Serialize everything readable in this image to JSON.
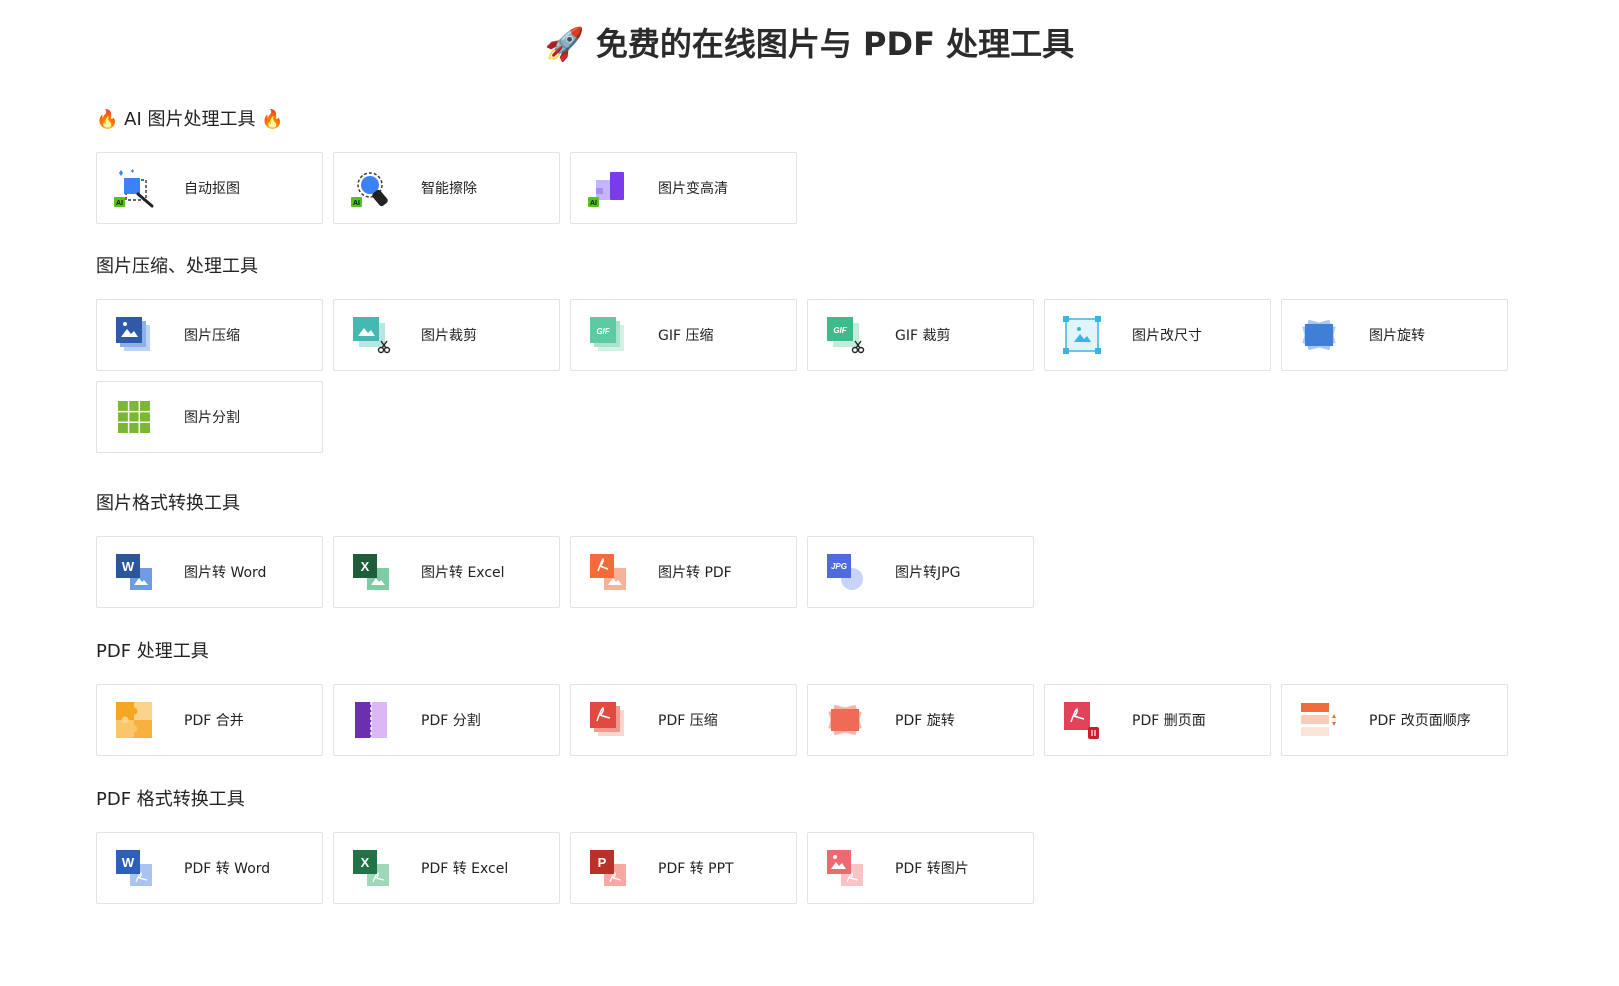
{
  "page": {
    "title": "🚀 免费的在线图片与 PDF 处理工具"
  },
  "sections": [
    {
      "title": "🔥 AI 图片处理工具 🔥",
      "items": [
        {
          "label": "自动抠图",
          "icon": "ai-cutout-icon"
        },
        {
          "label": "智能擦除",
          "icon": "ai-eraser-icon"
        },
        {
          "label": "图片变高清",
          "icon": "ai-enhance-icon"
        }
      ]
    },
    {
      "title": "图片压缩、处理工具",
      "items": [
        {
          "label": "图片压缩",
          "icon": "image-compress-icon"
        },
        {
          "label": "图片裁剪",
          "icon": "image-crop-icon"
        },
        {
          "label": "GIF 压缩",
          "icon": "gif-compress-icon"
        },
        {
          "label": "GIF 裁剪",
          "icon": "gif-crop-icon"
        },
        {
          "label": "图片改尺寸",
          "icon": "image-resize-icon"
        },
        {
          "label": "图片旋转",
          "icon": "image-rotate-icon"
        },
        {
          "label": "图片分割",
          "icon": "image-split-icon"
        }
      ]
    },
    {
      "title": "图片格式转换工具",
      "items": [
        {
          "label": "图片转 Word",
          "icon": "image-to-word-icon"
        },
        {
          "label": "图片转 Excel",
          "icon": "image-to-excel-icon"
        },
        {
          "label": "图片转 PDF",
          "icon": "image-to-pdf-icon"
        },
        {
          "label": "图片转JPG",
          "icon": "image-to-jpg-icon"
        }
      ]
    },
    {
      "title": "PDF 处理工具",
      "items": [
        {
          "label": "PDF 合并",
          "icon": "pdf-merge-icon"
        },
        {
          "label": "PDF 分割",
          "icon": "pdf-split-icon"
        },
        {
          "label": "PDF 压缩",
          "icon": "pdf-compress-icon"
        },
        {
          "label": "PDF 旋转",
          "icon": "pdf-rotate-icon"
        },
        {
          "label": "PDF 删页面",
          "icon": "pdf-delete-page-icon"
        },
        {
          "label": "PDF 改页面顺序",
          "icon": "pdf-reorder-icon"
        }
      ]
    },
    {
      "title": "PDF 格式转换工具",
      "items": [
        {
          "label": "PDF 转 Word",
          "icon": "pdf-to-word-icon"
        },
        {
          "label": "PDF 转 Excel",
          "icon": "pdf-to-excel-icon"
        },
        {
          "label": "PDF 转 PPT",
          "icon": "pdf-to-ppt-icon"
        },
        {
          "label": "PDF 转图片",
          "icon": "pdf-to-image-icon"
        }
      ]
    }
  ],
  "icon_text": {
    "ai": "AI",
    "gif": "GIF",
    "jpg": "JPG",
    "word": "W",
    "excel": "X",
    "ppt": "P"
  },
  "colors": {
    "word": "#2b579a",
    "excel": "#217346",
    "ppt": "#c43e1c",
    "pdf_red": "#e5534b",
    "ai_green": "#52c41a",
    "blue": "#3b82f6"
  }
}
